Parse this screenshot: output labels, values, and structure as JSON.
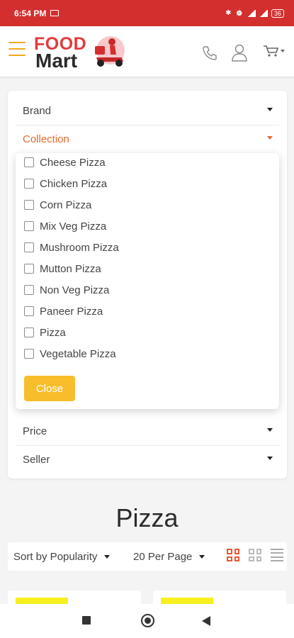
{
  "status_bar": {
    "time": "6:54 PM",
    "battery": "36"
  },
  "header": {
    "logo_line1": "FOOD",
    "logo_line2": "Mart",
    "icons": [
      "hamburger-menu-icon",
      "phone-icon",
      "user-icon",
      "cart-icon"
    ],
    "colors": {
      "hamburger": "#f0a81d",
      "logo_red": "#e23b3b"
    }
  },
  "filters": {
    "rows": [
      {
        "label": "Brand"
      },
      {
        "label": "Collection",
        "active": true
      },
      {
        "label": "Price"
      },
      {
        "label": "Seller"
      }
    ],
    "collection_options": [
      {
        "label": "Cheese Pizza",
        "checked": false
      },
      {
        "label": "Chicken Pizza",
        "checked": false
      },
      {
        "label": "Corn Pizza",
        "checked": false
      },
      {
        "label": "Mix Veg Pizza",
        "checked": false
      },
      {
        "label": "Mushroom Pizza",
        "checked": false
      },
      {
        "label": "Mutton Pizza",
        "checked": false
      },
      {
        "label": "Non Veg Pizza",
        "checked": false
      },
      {
        "label": "Paneer Pizza",
        "checked": false
      },
      {
        "label": "Pizza",
        "checked": false
      },
      {
        "label": "Vegetable Pizza",
        "checked": false
      }
    ],
    "close_label": "Close",
    "colors": {
      "active": "#e86a2f",
      "close_button": "#f8bd2a"
    }
  },
  "main": {
    "title": "Pizza",
    "sort_label": "Sort by Popularity",
    "per_page_label": "20 Per Page",
    "view_modes": [
      "grid-view-icon",
      "compact-grid-view-icon",
      "list-view-icon"
    ],
    "active_view": "grid-view-icon"
  },
  "nav_bar": {
    "icons": [
      "recent-apps-icon",
      "home-icon",
      "back-icon"
    ]
  }
}
